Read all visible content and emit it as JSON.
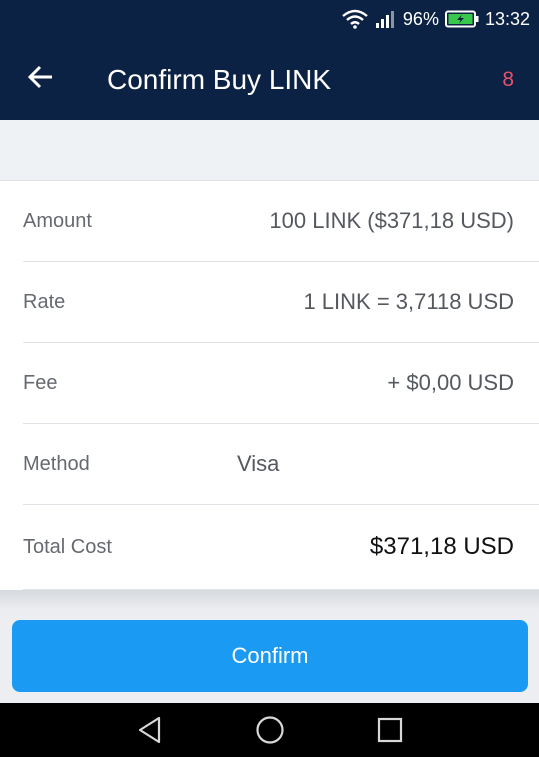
{
  "status_bar": {
    "battery_percent": "96%",
    "time": "13:32",
    "icons": [
      "wifi-icon",
      "signal-icon",
      "battery-charging-icon"
    ]
  },
  "toolbar": {
    "back_icon": "arrow-left-icon",
    "title": "Confirm Buy LINK",
    "badge": "8"
  },
  "details": {
    "amount": {
      "label": "Amount",
      "value": "100 LINK ($371,18 USD)"
    },
    "rate": {
      "label": "Rate",
      "value": "1 LINK = 3,7118 USD"
    },
    "fee": {
      "label": "Fee",
      "value": "+ $0,00 USD"
    },
    "method": {
      "label": "Method",
      "value": "Visa"
    },
    "total": {
      "label": "Total Cost",
      "value": "$371,18 USD"
    }
  },
  "confirm_label": "Confirm",
  "nav": [
    "nav-back-icon",
    "nav-home-icon",
    "nav-recents-icon"
  ],
  "colors": {
    "header_bg": "#0b2244",
    "accent": "#1a9af2",
    "badge": "#e8506a",
    "battery": "#39c94a"
  }
}
